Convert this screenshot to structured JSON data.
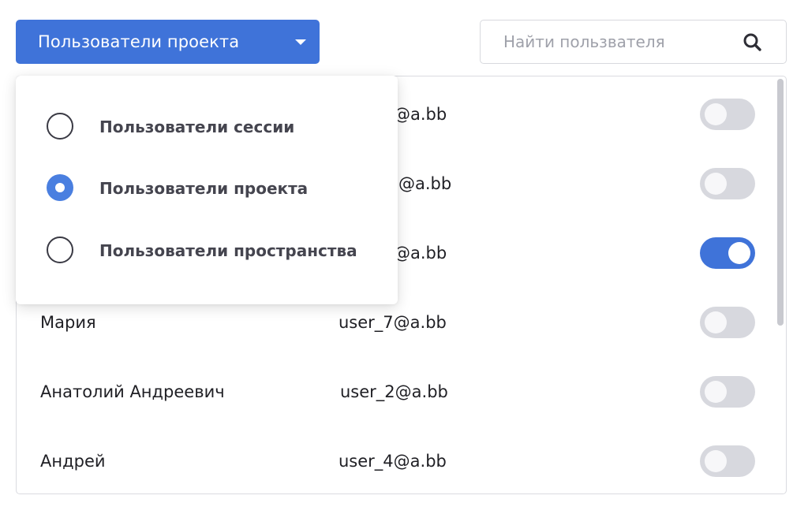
{
  "header": {
    "dropdown_label": "Пользователи проекта",
    "search_placeholder": "Найти пользвателя"
  },
  "menu": {
    "options": [
      {
        "label": "Пользователи сессии",
        "selected": false
      },
      {
        "label": "Пользователи проекта",
        "selected": true
      },
      {
        "label": "Пользователи пространства",
        "selected": false
      }
    ]
  },
  "users": [
    {
      "name": "",
      "email": "@a.bb",
      "enabled": false
    },
    {
      "name": "",
      "email": "@a.bb",
      "enabled": false
    },
    {
      "name": "",
      "email": "@a.bb",
      "enabled": true
    },
    {
      "name": "Мария",
      "email": "user_7@a.bb",
      "enabled": false
    },
    {
      "name": "Анатолий Андреевич",
      "email": "user_2@a.bb",
      "enabled": false
    },
    {
      "name": "Андрей",
      "email": "user_4@a.bb",
      "enabled": false
    }
  ],
  "icons": {
    "dropdown_caret": "caret-down-icon",
    "search": "search-icon"
  },
  "colors": {
    "accent": "#3f73d9",
    "toggle_off": "#d7d8de",
    "radio_selected": "#4a7fe0"
  }
}
